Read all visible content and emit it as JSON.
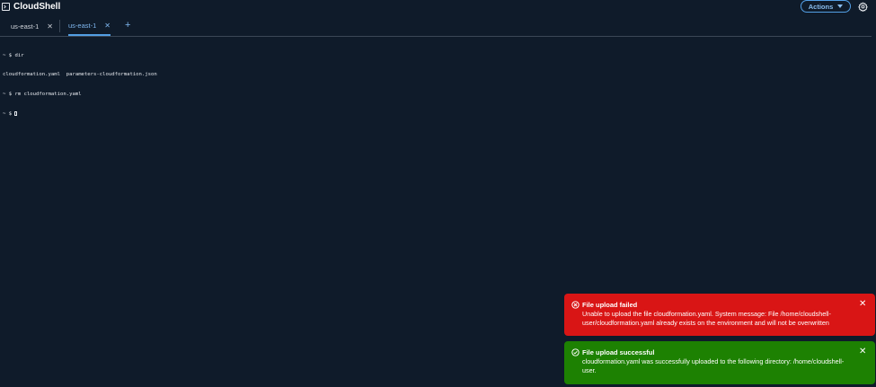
{
  "header": {
    "title": "CloudShell",
    "actions_label": "Actions"
  },
  "tabs": [
    {
      "label": "us-east-1",
      "close": "✕",
      "active": false
    },
    {
      "label": "us-east-1",
      "close": "✕",
      "active": true
    }
  ],
  "add_tab_label": "+",
  "terminal": {
    "lines": [
      "~ $ dir",
      "cloudformation.yaml  parameters-cloudformation.json",
      "~ $ rm cloudformation.yaml",
      "~ $ "
    ]
  },
  "notifications": {
    "error": {
      "title": "File upload failed",
      "message": "Unable to upload the file cloudformation.yaml. System message: File /home/cloudshell-user/cloudformation.yaml already exists on the environment and will not be overwritten",
      "close": "✕",
      "color": "#d91515"
    },
    "success": {
      "title": "File upload successful",
      "message": "cloudformation.yaml was successfully uploaded to the following directory: /home/cloudshell-user.",
      "close": "✕",
      "color": "#1d8102"
    }
  },
  "colors": {
    "background": "#0f1b2a",
    "accent": "#539fe5"
  }
}
